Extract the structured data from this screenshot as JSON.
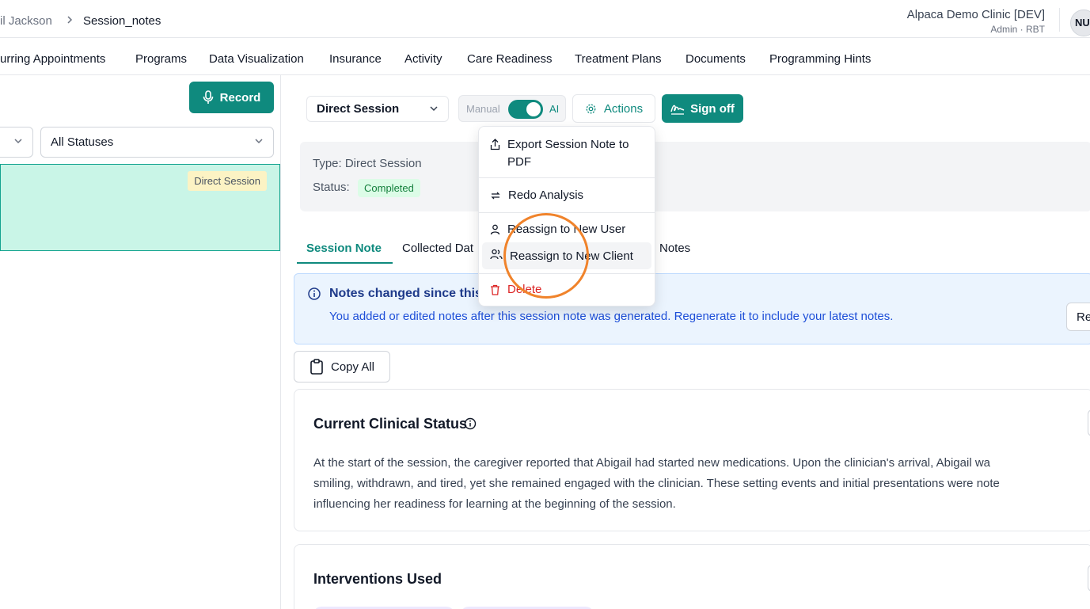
{
  "breadcrumb": {
    "prev": "il Jackson",
    "current": "Session_notes"
  },
  "clinic": {
    "name": "Alpaca Demo Clinic [DEV]",
    "role": "Admin · RBT"
  },
  "user": {
    "initials": "NU"
  },
  "nav": {
    "tabs": [
      "urring Appointments",
      "Programs",
      "Data Visualization",
      "Insurance",
      "Activity",
      "Care Readiness",
      "Treatment Plans",
      "Documents",
      "Programming Hints"
    ]
  },
  "left": {
    "record_label": "Record",
    "status_filter": "All Statuses",
    "session_type_badge": "Direct Session"
  },
  "toolbar": {
    "session_type": "Direct Session",
    "toggle_manual": "Manual",
    "toggle_ai": "AI",
    "actions_label": "Actions",
    "signoff_label": "Sign off"
  },
  "session_info": {
    "type_text": "Type: Direct Session",
    "status_label": "Status:",
    "status_value": "Completed"
  },
  "content_tabs": [
    "Session Note",
    "Collected Dat",
    "Notes"
  ],
  "alert": {
    "title": "Notes changed since this",
    "body": "You added or edited notes after this session note was generated. Regenerate it to include your latest notes.",
    "button": "Re"
  },
  "copy_all_label": "Copy All",
  "cards": {
    "clinical_status": {
      "title": "Current Clinical Status",
      "lines": [
        "At the start of the session, the caregiver reported that Abigail had started new medications. Upon the clinician's arrival, Abigail wa",
        "smiling, withdrawn, and tired, yet she remained engaged with the clinician. These setting events and initial presentations were note",
        "influencing her readiness for learning at the beginning of the session."
      ]
    },
    "interventions": {
      "title": "Interventions Used"
    }
  },
  "menu": {
    "items": [
      {
        "label_line1": "Export Session Note to",
        "label_line2": "PDF",
        "icon": "export-icon"
      },
      {
        "label": "Redo Analysis",
        "icon": "redo-icon"
      },
      {
        "label": "Reassign to New User",
        "icon": "user-icon"
      },
      {
        "label": "Reassign to New Client",
        "icon": "users-icon"
      },
      {
        "label": "Delete",
        "icon": "trash-icon"
      }
    ]
  },
  "colors": {
    "accent": "#0f8a7e",
    "danger": "#dc2626",
    "highlight_ring": "#f0832b"
  }
}
